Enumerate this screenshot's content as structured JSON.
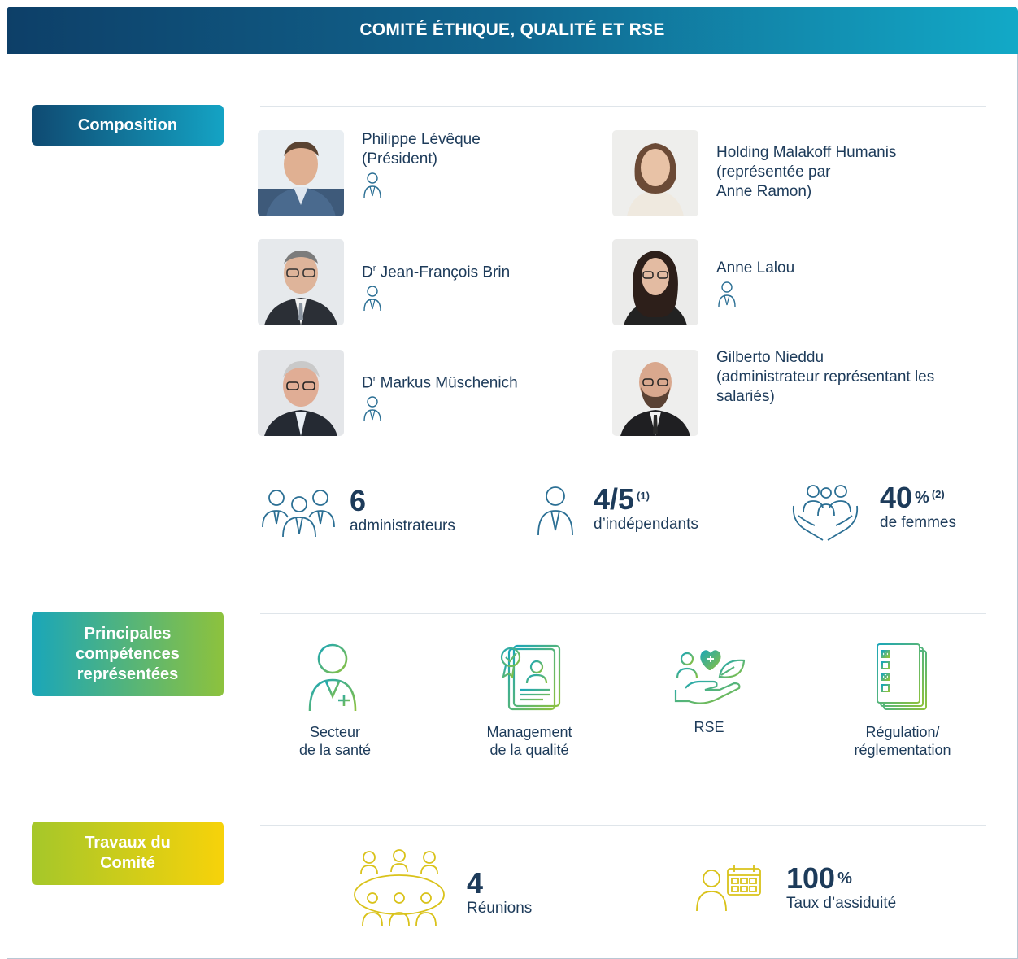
{
  "header": {
    "title": "COMITÉ ÉTHIQUE, QUALITÉ ET RSE"
  },
  "sections": {
    "composition": "Composition",
    "skills": "Principales compétences représentées",
    "work": "Travaux du Comité"
  },
  "members": [
    {
      "name": "Philippe Lévêque",
      "role": "(Président)"
    },
    {
      "name": "Holding Malakoff Humanis",
      "role": "(représentée par Anne Ramon)"
    },
    {
      "name_prefix": "D",
      "name_sup": "r",
      "name": " Jean-François Brin",
      "role": ""
    },
    {
      "name": "Anne Lalou",
      "role": ""
    },
    {
      "name_prefix": "D",
      "name_sup": "r",
      "name": " Markus Müschenich",
      "role": ""
    },
    {
      "name": "Gilberto Nieddu",
      "role": "(administrateur représentant les salariés)"
    }
  ],
  "stats": {
    "administrators": {
      "value": "6",
      "label": "administrateurs"
    },
    "independents": {
      "value": "4/5",
      "note": "(1)",
      "label": "d’indépendants"
    },
    "women": {
      "value": "40",
      "unit": "%",
      "note": "(2)",
      "label": "de femmes"
    }
  },
  "skills": [
    {
      "label": "Secteur\nde la santé",
      "icon": "healthcare-professional-icon"
    },
    {
      "label": "Management\nde la qualité",
      "icon": "quality-certificate-icon"
    },
    {
      "label": "RSE",
      "icon": "csr-hand-heart-leaf-icon"
    },
    {
      "label": "Régulation/\nréglementation",
      "icon": "regulation-checklist-icon"
    }
  ],
  "work": {
    "meetings": {
      "value": "4",
      "label": "Réunions"
    },
    "attendance": {
      "value": "100",
      "unit": "%",
      "label": "Taux d’assiduité"
    }
  },
  "colors": {
    "navy": "#1d3b5a",
    "teal": "#14a3c4",
    "green": "#8dc23d",
    "yellow": "#f7d20a",
    "icon_blue": "#2b6f94",
    "icon_yellow": "#d9c21a"
  }
}
